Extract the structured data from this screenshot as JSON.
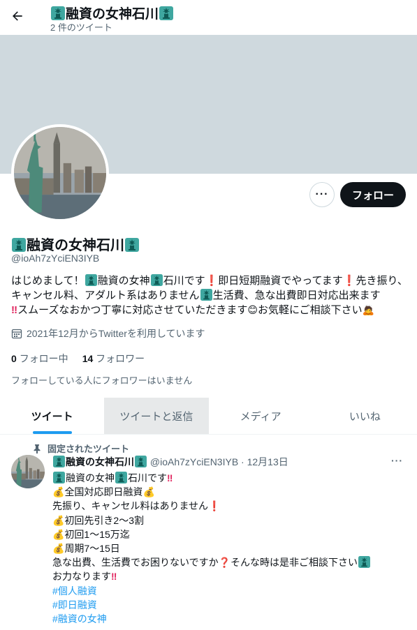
{
  "header": {
    "name": "融資の女神石川",
    "tweet_count": "2 件のツイート"
  },
  "profile": {
    "display_name": "融資の女神石川",
    "handle": "@ioAh7zYciEN3IYB",
    "joined": "2021年12月からTwitterを利用しています",
    "following_count": "0",
    "following_label": "フォロー中",
    "followers_count": "14",
    "followers_label": "フォロワー",
    "followers_note": "フォローしている人にフォロワーはいません",
    "follow_button": "フォロー"
  },
  "bio": {
    "p1": "はじめまして！",
    "p2": "融資の女神",
    "p3": "石川です",
    "p4": "即日短期融資でやってます",
    "p5": "先き振り、キャンセル料、アダルト系はありません",
    "p6": "生活費、急な出費即日対応出来ます",
    "p7": "スムーズなおかつ丁寧に対応させていただきます",
    "p8": "お気軽にご相談下さい"
  },
  "tabs": [
    {
      "label": "ツイート"
    },
    {
      "label": "ツイートと返信"
    },
    {
      "label": "メディア"
    },
    {
      "label": "いいね"
    }
  ],
  "tweet": {
    "pinned_label": "固定されたツイート",
    "author_name": "融資の女神石川",
    "meta": "@ioAh7zYciEN3IYB · 12月13日",
    "l1a": "融資の女神",
    "l1b": "石川です",
    "l2": "全国対応即日融資",
    "l3": "先振り、キャンセル料はありません",
    "l4": "初回先引き2～3割",
    "l5": "初回1～15万迄",
    "l6": "周期7～15日",
    "l7": "急な出費、生活費でお困りないですか",
    "l7b": "そんな時は是非ご相談下さい",
    "l8": "お力なります",
    "hashtags": [
      "#個人融資",
      "#即日融資",
      "#融資の女神"
    ]
  },
  "icons": {
    "back": "back-arrow-icon",
    "statue": "statue-of-liberty-icon",
    "more": "more-dots-icon",
    "calendar": "calendar-icon",
    "pin": "pin-icon",
    "money": "money-bag-icon",
    "exclaim": "double-exclamation-icon"
  },
  "colors": {
    "accent": "#1d9bf0",
    "text": "#0f1419",
    "muted": "#536471",
    "banner": "#cfd9de",
    "follow_button_bg": "#0f1419"
  }
}
